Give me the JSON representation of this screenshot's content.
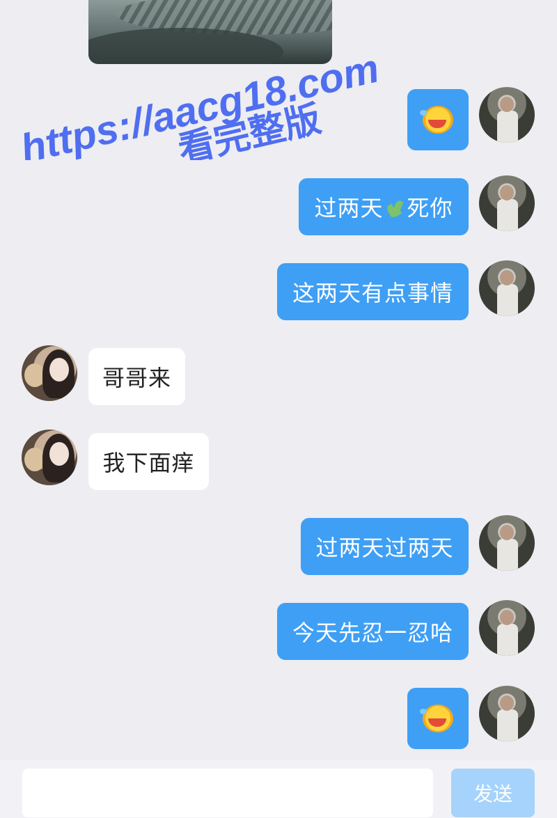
{
  "watermark": {
    "url": "https://aacg18.com",
    "subtitle": "看完整版"
  },
  "messages": [
    {
      "from": "self",
      "type": "emoji",
      "emoji": "laughing-tears-emoji"
    },
    {
      "from": "self",
      "type": "text",
      "before": "过两天",
      "icon": "leaf-emoji",
      "after": "死你"
    },
    {
      "from": "self",
      "type": "text",
      "text": "这两天有点事情"
    },
    {
      "from": "other",
      "type": "text",
      "text": "哥哥来"
    },
    {
      "from": "other",
      "type": "text",
      "text": "我下面痒"
    },
    {
      "from": "self",
      "type": "text",
      "text": "过两天过两天"
    },
    {
      "from": "self",
      "type": "text",
      "text": "今天先忍一忍哈"
    },
    {
      "from": "self",
      "type": "emoji",
      "emoji": "laughing-tears-emoji"
    }
  ],
  "composer": {
    "input_value": "",
    "send_label": "发送"
  },
  "colors": {
    "self_bubble": "#3e9ff5",
    "other_bubble": "#ffffff",
    "background": "#ededf2",
    "send_disabled": "#a6d3fb",
    "watermark": "#4f6ef0"
  }
}
